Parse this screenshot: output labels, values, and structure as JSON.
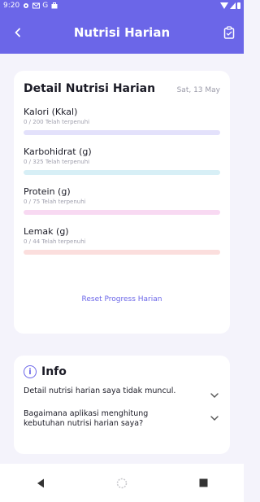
{
  "status_bar": {
    "time": "9:20",
    "icons": [
      "gear-icon",
      "gmail-icon",
      "google-icon",
      "briefcase-icon",
      "wifi-icon",
      "signal-icon",
      "battery-icon"
    ]
  },
  "app_bar": {
    "title": "Nutrisi Harian",
    "left_icon": "back-arrow-icon",
    "right_icon": "clipboard-icon",
    "color": "#6b66e8"
  },
  "detail_card": {
    "title": "Detail Nutrisi Harian",
    "date": "Sat, 13 May",
    "nutrients": [
      {
        "label": "Kalori (Kkal)",
        "status": "0 / 200 Telah terpenuhi",
        "progress": 0,
        "track_color": "#e3e1fb"
      },
      {
        "label": "Karbohidrat (g)",
        "status": "0 / 325 Telah terpenuhi",
        "progress": 0,
        "track_color": "#d7eff6"
      },
      {
        "label": "Protein (g)",
        "status": "0 / 75 Telah terpenuhi",
        "progress": 0,
        "track_color": "#f8d9f2"
      },
      {
        "label": "Lemak (g)",
        "status": "0 / 44 Telah terpenuhi",
        "progress": 0,
        "track_color": "#fbdedd"
      }
    ],
    "reset_label": "Reset Progress Harian"
  },
  "info_card": {
    "title": "Info",
    "icon": "info-icon",
    "faqs": [
      {
        "question": "Detail nutrisi harian saya tidak muncul."
      },
      {
        "question": "Bagaimana aplikasi menghitung kebutuhan nutrisi harian saya?"
      }
    ]
  },
  "nav_bar": {
    "buttons": [
      "back-triangle-icon",
      "home-circle-icon",
      "recents-square-icon"
    ]
  }
}
